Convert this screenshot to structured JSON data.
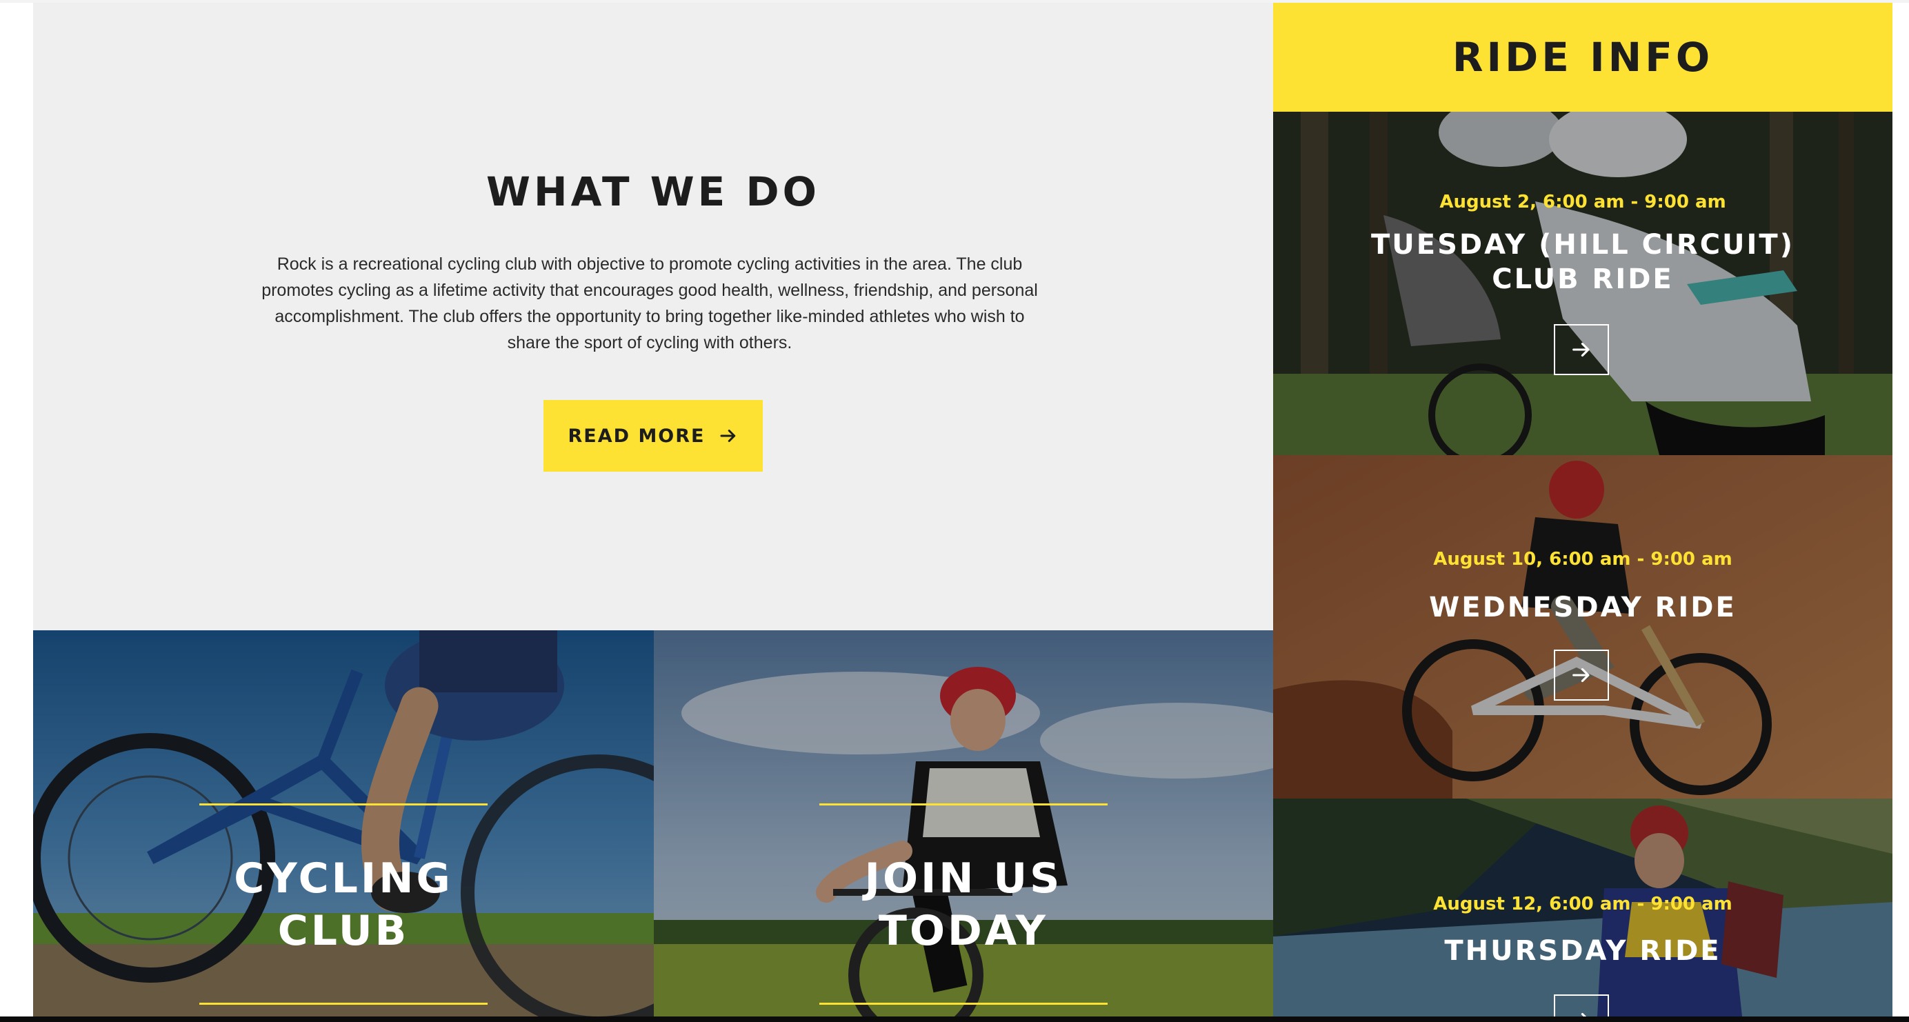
{
  "what_we_do": {
    "title": "WHAT WE DO",
    "body": "Rock is a recreational cycling club with objective to promote cycling activities in the area. The club promotes cycling as a lifetime activity that encourages good health, wellness, friendship, and personal accomplishment. The club offers the opportunity to bring together like-minded athletes who wish to share the sport of cycling with others.",
    "button_label": "READ MORE",
    "button_icon": "arrow-right-icon"
  },
  "promos": [
    {
      "line1": "CYCLING",
      "line2": "CLUB"
    },
    {
      "line1": "JOIN US",
      "line2": "TODAY"
    }
  ],
  "ride_info": {
    "title": "RIDE INFO",
    "rides": [
      {
        "date": "August 2, 6:00 am - 9:00 am",
        "name_line1": "TUESDAY (HILL CIRCUIT)",
        "name_line2": "CLUB RIDE",
        "icon": "arrow-right-icon"
      },
      {
        "date": "August 10, 6:00 am - 9:00 am",
        "name_line1": "WEDNESDAY RIDE",
        "name_line2": "",
        "icon": "arrow-right-icon"
      },
      {
        "date": "August 12, 6:00 am - 9:00 am",
        "name_line1": "THURSDAY RIDE",
        "name_line2": "",
        "icon": "arrow-right-icon"
      }
    ]
  },
  "colors": {
    "accent": "#fee233",
    "section_bg": "#efefef",
    "heading": "#1d1d1d",
    "white": "#ffffff"
  }
}
